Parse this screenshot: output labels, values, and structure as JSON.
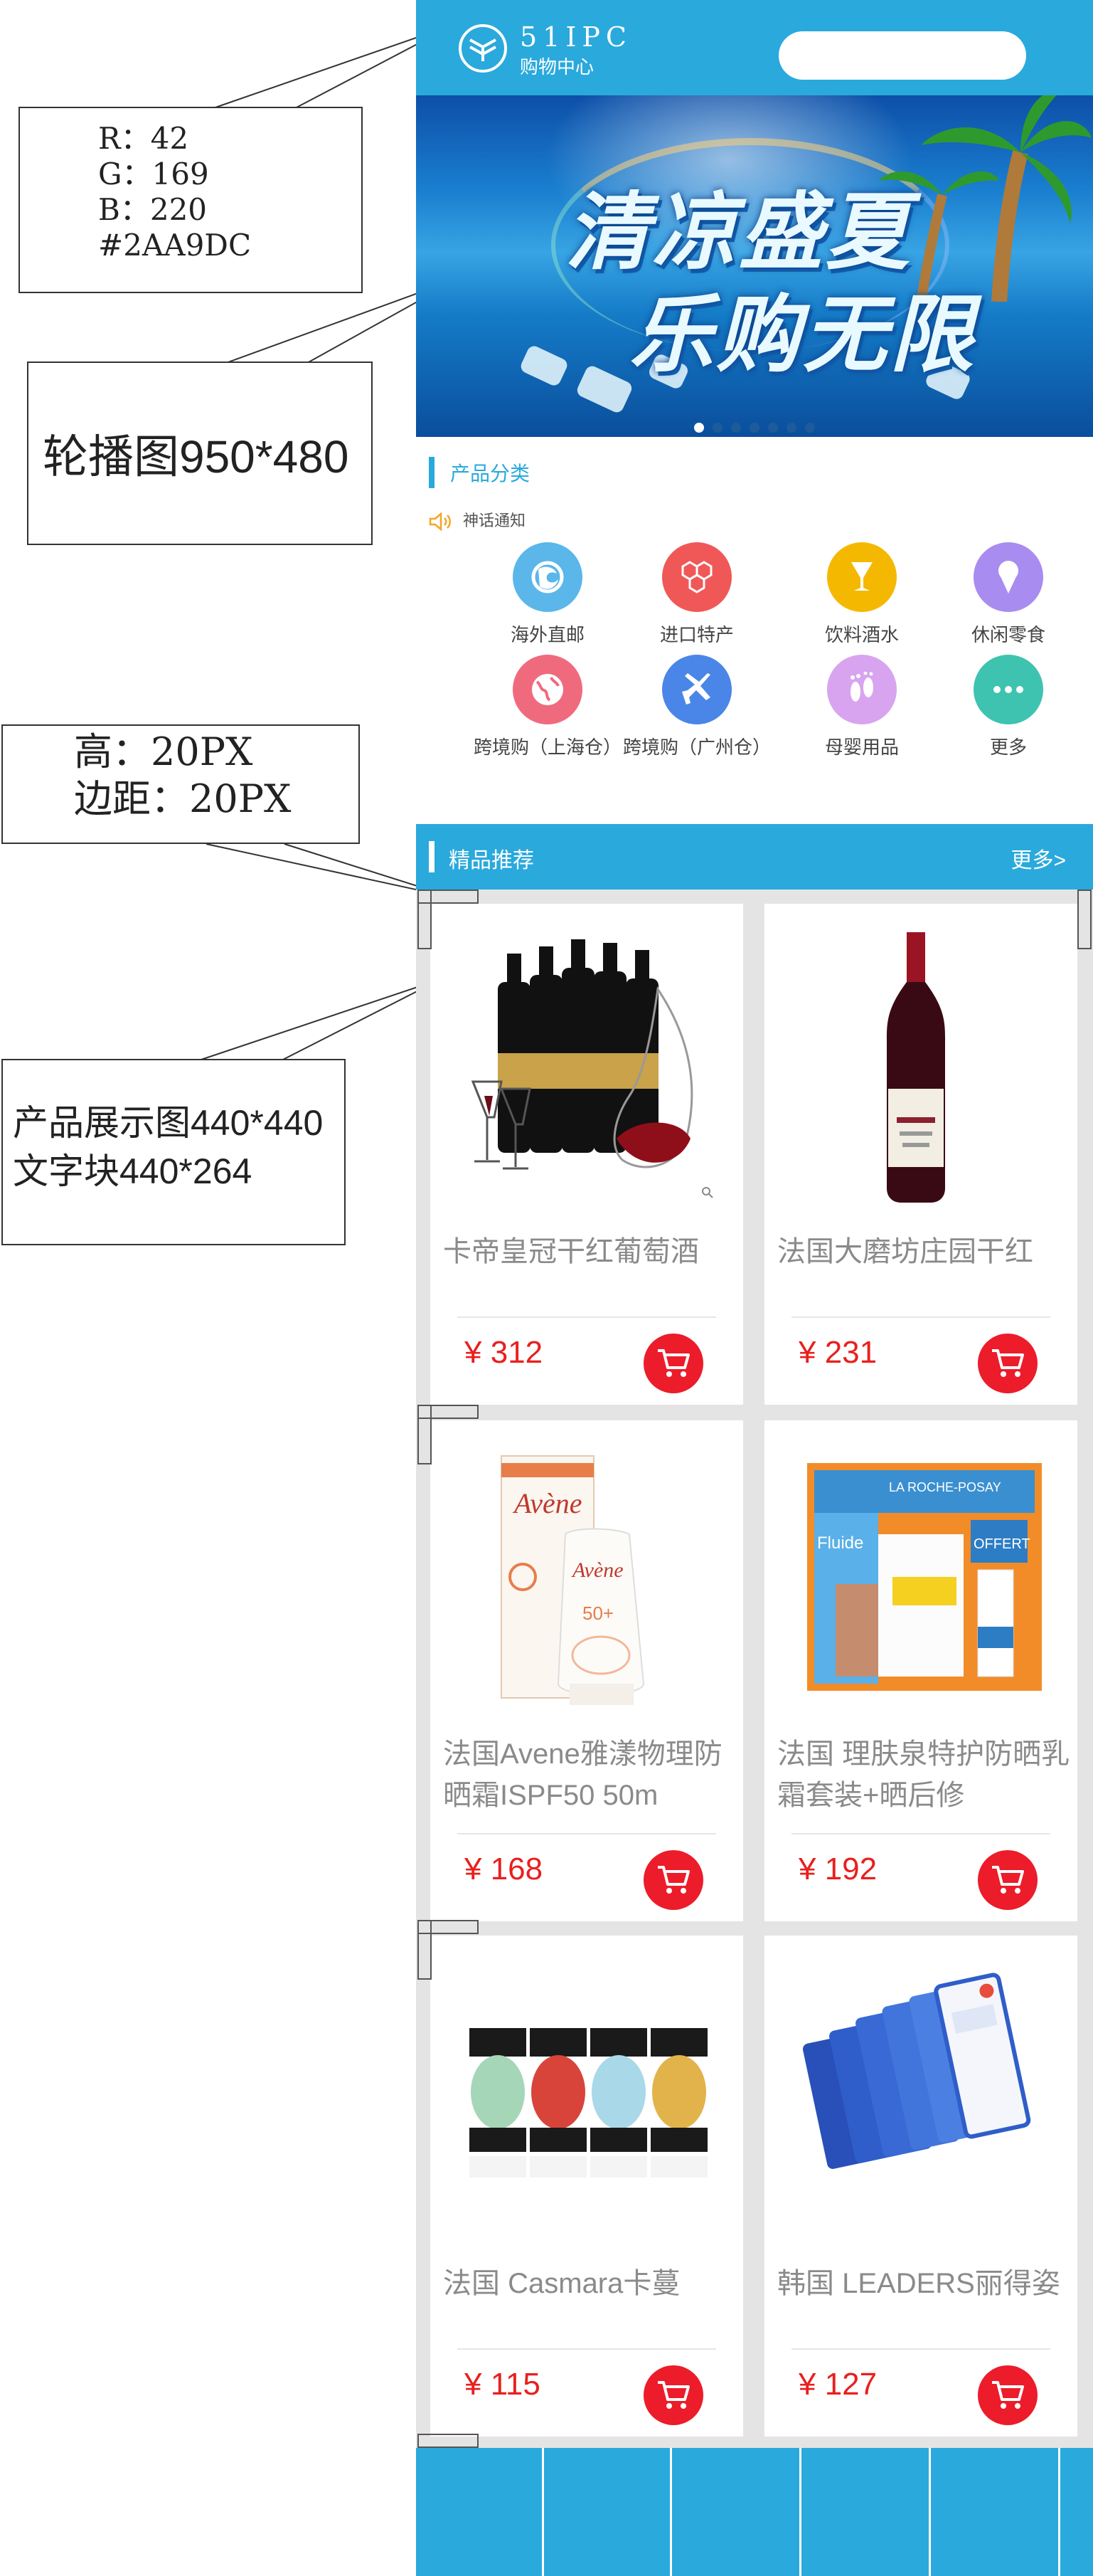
{
  "annotations": {
    "color": {
      "r": "R：42",
      "g": "G：169",
      "b": "B：220",
      "hex": "#2AA9DC"
    },
    "carousel": "轮播图950*480",
    "spacing": {
      "height": "高：20PX",
      "margin": "边距：20PX"
    },
    "product": {
      "image": "产品展示图440*440",
      "text": "文字块440*264"
    }
  },
  "header": {
    "logo_name": "51IPC",
    "logo_sub": "购物中心",
    "search_placeholder": ""
  },
  "banner": {
    "title": "清凉盛夏",
    "subtitle": "乐购无限",
    "slide_count": 7,
    "active_slide": 1
  },
  "categories": {
    "title": "产品分类",
    "notice": "神话通知",
    "items": [
      {
        "label": "海外直邮",
        "icon": "firefox-globe-icon",
        "color": "#5bb6ea"
      },
      {
        "label": "进口特产",
        "icon": "hexagons-icon",
        "color": "#f05858"
      },
      {
        "label": "饮料酒水",
        "icon": "wine-glass-icon",
        "color": "#f5b800"
      },
      {
        "label": "休闲零食",
        "icon": "ice-cream-icon",
        "color": "#a88cf0"
      },
      {
        "label": "跨境购（上海仓）",
        "icon": "globe-icon",
        "color": "#f06a7e"
      },
      {
        "label": "跨境购（广州仓）",
        "icon": "airplane-icon",
        "color": "#4a86e8"
      },
      {
        "label": "母婴用品",
        "icon": "footprints-icon",
        "color": "#d8a4f0"
      },
      {
        "label": "更多",
        "icon": "more-dots-icon",
        "color": "#3ec3b0"
      }
    ]
  },
  "recommend": {
    "title": "精品推荐",
    "more": "更多>"
  },
  "products": [
    {
      "name": "卡帝皇冠干红葡萄酒",
      "price": "¥ 312"
    },
    {
      "name": "法国大磨坊庄园干红",
      "price": "¥ 231"
    },
    {
      "name": "法国Avene雅漾物理防晒霜ISPF50 50m",
      "price": "¥ 168"
    },
    {
      "name": "法国 理肤泉特护防晒乳霜套装+晒后修",
      "price": "¥ 192"
    },
    {
      "name": "法国 Casmara卡蔓",
      "price": "¥ 115"
    },
    {
      "name": "韩国 LEADERS丽得姿",
      "price": "¥ 127"
    }
  ],
  "colors": {
    "brand": "#2AA9DC",
    "price": "#E8201E",
    "cart": "#EC1C2A",
    "background": "#E4E4E4"
  }
}
